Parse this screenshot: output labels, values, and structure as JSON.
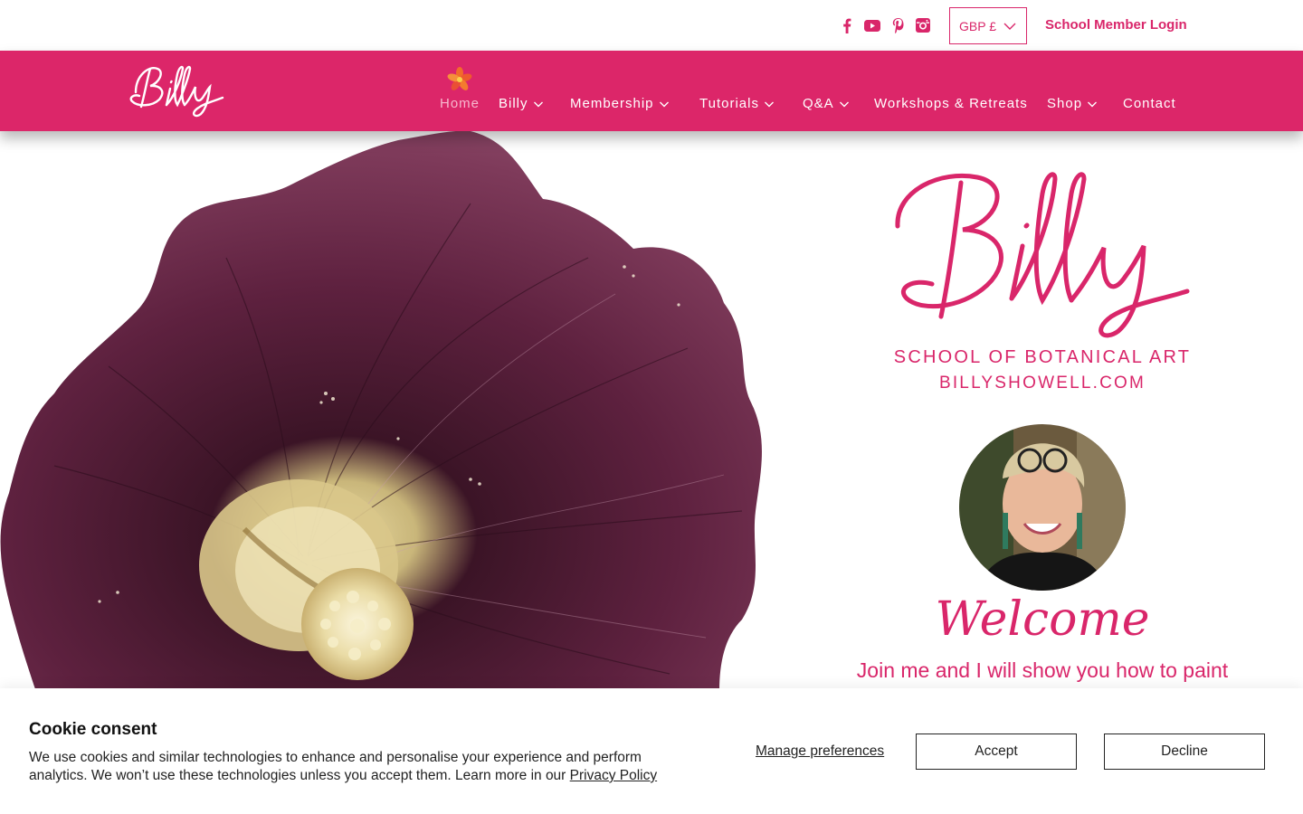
{
  "topbar": {
    "social_icons": [
      "facebook-icon",
      "youtube-icon",
      "pinterest-icon",
      "instagram-icon"
    ],
    "currency": "GBP £",
    "member_login": "School Member Login"
  },
  "nav": {
    "logo_text": "Billy",
    "items": [
      {
        "label": "Home",
        "active": true,
        "dropdown": false
      },
      {
        "label": "Billy",
        "active": false,
        "dropdown": true
      },
      {
        "label": "Membership",
        "active": false,
        "dropdown": true
      },
      {
        "label": "Tutorials",
        "active": false,
        "dropdown": true
      },
      {
        "label": "Q&A",
        "active": false,
        "dropdown": true
      },
      {
        "label": "Workshops & Retreats",
        "active": false,
        "dropdown": false
      },
      {
        "label": "Shop",
        "active": false,
        "dropdown": true
      },
      {
        "label": "Contact",
        "active": false,
        "dropdown": false
      }
    ]
  },
  "hero": {
    "logo_text": "Billy",
    "subtitle": "SCHOOL OF BOTANICAL ART",
    "website": "BILLYSHOWELL.COM",
    "welcome": "Welcome",
    "tagline": "Join me and I will show you how to paint"
  },
  "cookie": {
    "title": "Cookie consent",
    "text": "We use cookies and similar technologies to enhance and personalise your experience and perform analytics. We won’t use these technologies unless you accept them. Learn more in our ",
    "policy_link": "Privacy Policy",
    "manage": "Manage preferences",
    "accept": "Accept",
    "decline": "Decline"
  },
  "colors": {
    "brand_pink": "#d9266a",
    "nav_bg": "#dc2669",
    "flower_dark": "#3a1326",
    "flower_mid": "#6e2a4a"
  }
}
